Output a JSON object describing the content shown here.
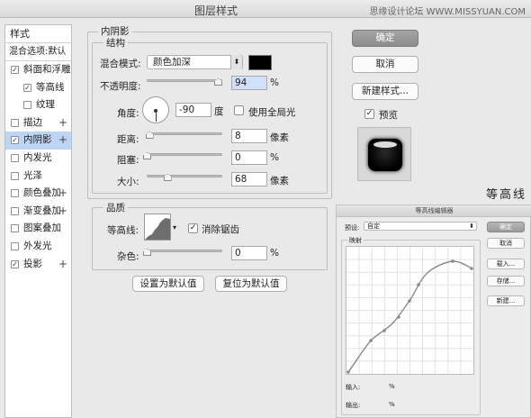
{
  "window": {
    "title": "图层样式",
    "watermark": "思缘设计论坛 WWW.MISSYUAN.COM"
  },
  "styles_panel": {
    "header": "样式",
    "blend_options": "混合选项:默认",
    "items": [
      {
        "label": "斜面和浮雕",
        "checked": true,
        "sub": false,
        "selected": false,
        "plus": false
      },
      {
        "label": "等高线",
        "checked": true,
        "sub": true,
        "selected": false,
        "plus": false
      },
      {
        "label": "纹理",
        "checked": false,
        "sub": true,
        "selected": false,
        "plus": false
      },
      {
        "label": "描边",
        "checked": false,
        "sub": false,
        "selected": false,
        "plus": true
      },
      {
        "label": "内阴影",
        "checked": true,
        "sub": false,
        "selected": true,
        "plus": true
      },
      {
        "label": "内发光",
        "checked": false,
        "sub": false,
        "selected": false,
        "plus": false
      },
      {
        "label": "光泽",
        "checked": false,
        "sub": false,
        "selected": false,
        "plus": false
      },
      {
        "label": "颜色叠加",
        "checked": false,
        "sub": false,
        "selected": false,
        "plus": true
      },
      {
        "label": "渐变叠加",
        "checked": false,
        "sub": false,
        "selected": false,
        "plus": true
      },
      {
        "label": "图案叠加",
        "checked": false,
        "sub": false,
        "selected": false,
        "plus": false
      },
      {
        "label": "外发光",
        "checked": false,
        "sub": false,
        "selected": false,
        "plus": false
      },
      {
        "label": "投影",
        "checked": true,
        "sub": false,
        "selected": false,
        "plus": true
      }
    ]
  },
  "inner_shadow": {
    "section_title": "内阴影",
    "structure": {
      "title": "结构",
      "blend_mode_label": "混合模式:",
      "blend_mode_value": "颜色加深",
      "blend_color": "#000000",
      "opacity_label": "不透明度:",
      "opacity_value": "94",
      "opacity_unit": "%",
      "opacity_level": 0.94,
      "angle_label": "角度:",
      "angle_value": "-90",
      "angle_unit": "度",
      "global_light_label": "使用全局光",
      "global_light_checked": false,
      "distance_label": "距离:",
      "distance_value": "8",
      "distance_unit": "像素",
      "distance_level": 0.03,
      "choke_label": "阻塞:",
      "choke_value": "0",
      "choke_unit": "%",
      "choke_level": 0.0,
      "size_label": "大小:",
      "size_value": "68",
      "size_unit": "像素",
      "size_level": 0.27
    },
    "quality": {
      "title": "品质",
      "contour_label": "等高线:",
      "anti_alias_label": "消除锯齿",
      "anti_alias_checked": true,
      "noise_label": "杂色:",
      "noise_value": "0",
      "noise_unit": "%",
      "noise_level": 0.0
    },
    "set_default_label": "设置为默认值",
    "reset_default_label": "复位为默认值"
  },
  "actions": {
    "ok_label": "确定",
    "cancel_label": "取消",
    "new_style_label": "新建样式...",
    "preview_label": "预览",
    "preview_checked": true
  },
  "side_title": "等高线",
  "contour_editor": {
    "title": "等高线编辑器",
    "preset_label": "预设:",
    "preset_value": "自定",
    "mapping_label": "映射",
    "input_label": "输入:",
    "input_unit": "%",
    "output_label": "输出:",
    "output_unit": "%",
    "ok_label": "确定",
    "cancel_label": "取消",
    "load_label": "载入...",
    "save_label": "存储...",
    "new_label": "新建..."
  },
  "colors": {
    "selection": "#bdd4f3",
    "highlight_input": "#cfe0fb"
  }
}
